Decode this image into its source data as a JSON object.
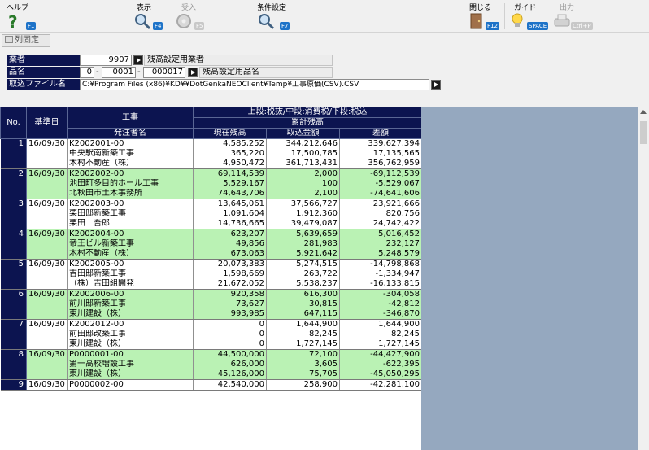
{
  "toolbar": {
    "help": {
      "label": "ヘルプ",
      "key": "F1"
    },
    "view": {
      "label": "表示",
      "key": "F4"
    },
    "receive": {
      "label": "受入",
      "key": "F5"
    },
    "condition": {
      "label": "条件設定",
      "key": "F7"
    },
    "close": {
      "label": "閉じる",
      "key": "F12"
    },
    "guide": {
      "label": "ガイド",
      "key": "SPACE"
    },
    "output": {
      "label": "出力",
      "key": "Ctrl+P"
    }
  },
  "fix_columns_label": "列固定",
  "filters": {
    "vendor": {
      "label": "業者",
      "code": "9907",
      "name": "残高設定用業者"
    },
    "item": {
      "label": "品名",
      "code1": "0",
      "code2": "0001",
      "code3": "000017",
      "name": "残高設定用品名"
    },
    "import_file": {
      "label": "取込ファイル名",
      "path": "C:¥Program Files (x86)¥KD¥¥DotGenkaNEOClient¥Temp¥工事原価(CSV).CSV"
    }
  },
  "grid": {
    "headers": {
      "no": "No.",
      "date": "基準日",
      "project": "工事",
      "client": "発注者名",
      "tax_note": "上段:税抜/中段:消費税/下段:税込",
      "cumulative": "累計残高",
      "current": "現在残高",
      "imported": "取込金額",
      "diff": "差額"
    },
    "rows": [
      {
        "no": "1",
        "date": "16/09/30",
        "lines": [
          {
            "text": "K2002001-00",
            "current": "4,585,252",
            "imported": "344,212,646",
            "diff": "339,627,394"
          },
          {
            "text": "中央駅南新築工事",
            "current": "365,220",
            "imported": "17,500,785",
            "diff": "17,135,565"
          },
          {
            "text": "木村不動産（株）",
            "current": "4,950,472",
            "imported": "361,713,431",
            "diff": "356,762,959"
          }
        ]
      },
      {
        "no": "2",
        "date": "16/09/30",
        "lines": [
          {
            "text": "K2002002-00",
            "current": "69,114,539",
            "imported": "2,000",
            "diff": "-69,112,539"
          },
          {
            "text": "池田町多目的ホール工事",
            "current": "5,529,167",
            "imported": "100",
            "diff": "-5,529,067"
          },
          {
            "text": "北秋田市土木事務所",
            "current": "74,643,706",
            "imported": "2,100",
            "diff": "-74,641,606"
          }
        ]
      },
      {
        "no": "3",
        "date": "16/09/30",
        "lines": [
          {
            "text": "K2002003-00",
            "current": "13,645,061",
            "imported": "37,566,727",
            "diff": "23,921,666"
          },
          {
            "text": "栗田邸新築工事",
            "current": "1,091,604",
            "imported": "1,912,360",
            "diff": "820,756"
          },
          {
            "text": "栗田　吾郎",
            "current": "14,736,665",
            "imported": "39,479,087",
            "diff": "24,742,422"
          }
        ]
      },
      {
        "no": "4",
        "date": "16/09/30",
        "lines": [
          {
            "text": "K2002004-00",
            "current": "623,207",
            "imported": "5,639,659",
            "diff": "5,016,452"
          },
          {
            "text": "帝王ビル新築工事",
            "current": "49,856",
            "imported": "281,983",
            "diff": "232,127"
          },
          {
            "text": "木村不動産（株）",
            "current": "673,063",
            "imported": "5,921,642",
            "diff": "5,248,579"
          }
        ]
      },
      {
        "no": "5",
        "date": "16/09/30",
        "lines": [
          {
            "text": "K2002005-00",
            "current": "20,073,383",
            "imported": "5,274,515",
            "diff": "-14,798,868"
          },
          {
            "text": "吉田邸新築工事",
            "current": "1,598,669",
            "imported": "263,722",
            "diff": "-1,334,947"
          },
          {
            "text": "（株）吉田組開発",
            "current": "21,672,052",
            "imported": "5,538,237",
            "diff": "-16,133,815"
          }
        ]
      },
      {
        "no": "6",
        "date": "16/09/30",
        "lines": [
          {
            "text": "K2002006-00",
            "current": "920,358",
            "imported": "616,300",
            "diff": "-304,058"
          },
          {
            "text": "前川邸新築工事",
            "current": "73,627",
            "imported": "30,815",
            "diff": "-42,812"
          },
          {
            "text": "東川建設（株）",
            "current": "993,985",
            "imported": "647,115",
            "diff": "-346,870"
          }
        ]
      },
      {
        "no": "7",
        "date": "16/09/30",
        "lines": [
          {
            "text": "K2002012-00",
            "current": "0",
            "imported": "1,644,900",
            "diff": "1,644,900"
          },
          {
            "text": "前田邸改築工事",
            "current": "0",
            "imported": "82,245",
            "diff": "82,245"
          },
          {
            "text": "東川建設（株）",
            "current": "0",
            "imported": "1,727,145",
            "diff": "1,727,145"
          }
        ]
      },
      {
        "no": "8",
        "date": "16/09/30",
        "lines": [
          {
            "text": "P0000001-00",
            "current": "44,500,000",
            "imported": "72,100",
            "diff": "-44,427,900"
          },
          {
            "text": "第一高校増設工事",
            "current": "626,000",
            "imported": "3,605",
            "diff": "-622,395"
          },
          {
            "text": "東川建設（株）",
            "current": "45,126,000",
            "imported": "75,705",
            "diff": "-45,050,295"
          }
        ]
      },
      {
        "no": "9",
        "date": "16/09/30",
        "lines": [
          {
            "text": "P0000002-00",
            "current": "42,540,000",
            "imported": "258,900",
            "diff": "-42,281,100"
          }
        ]
      }
    ]
  },
  "colors": {
    "header": "#0c1450",
    "highlight": "#baf2b4",
    "panel": "#95a8bf"
  }
}
